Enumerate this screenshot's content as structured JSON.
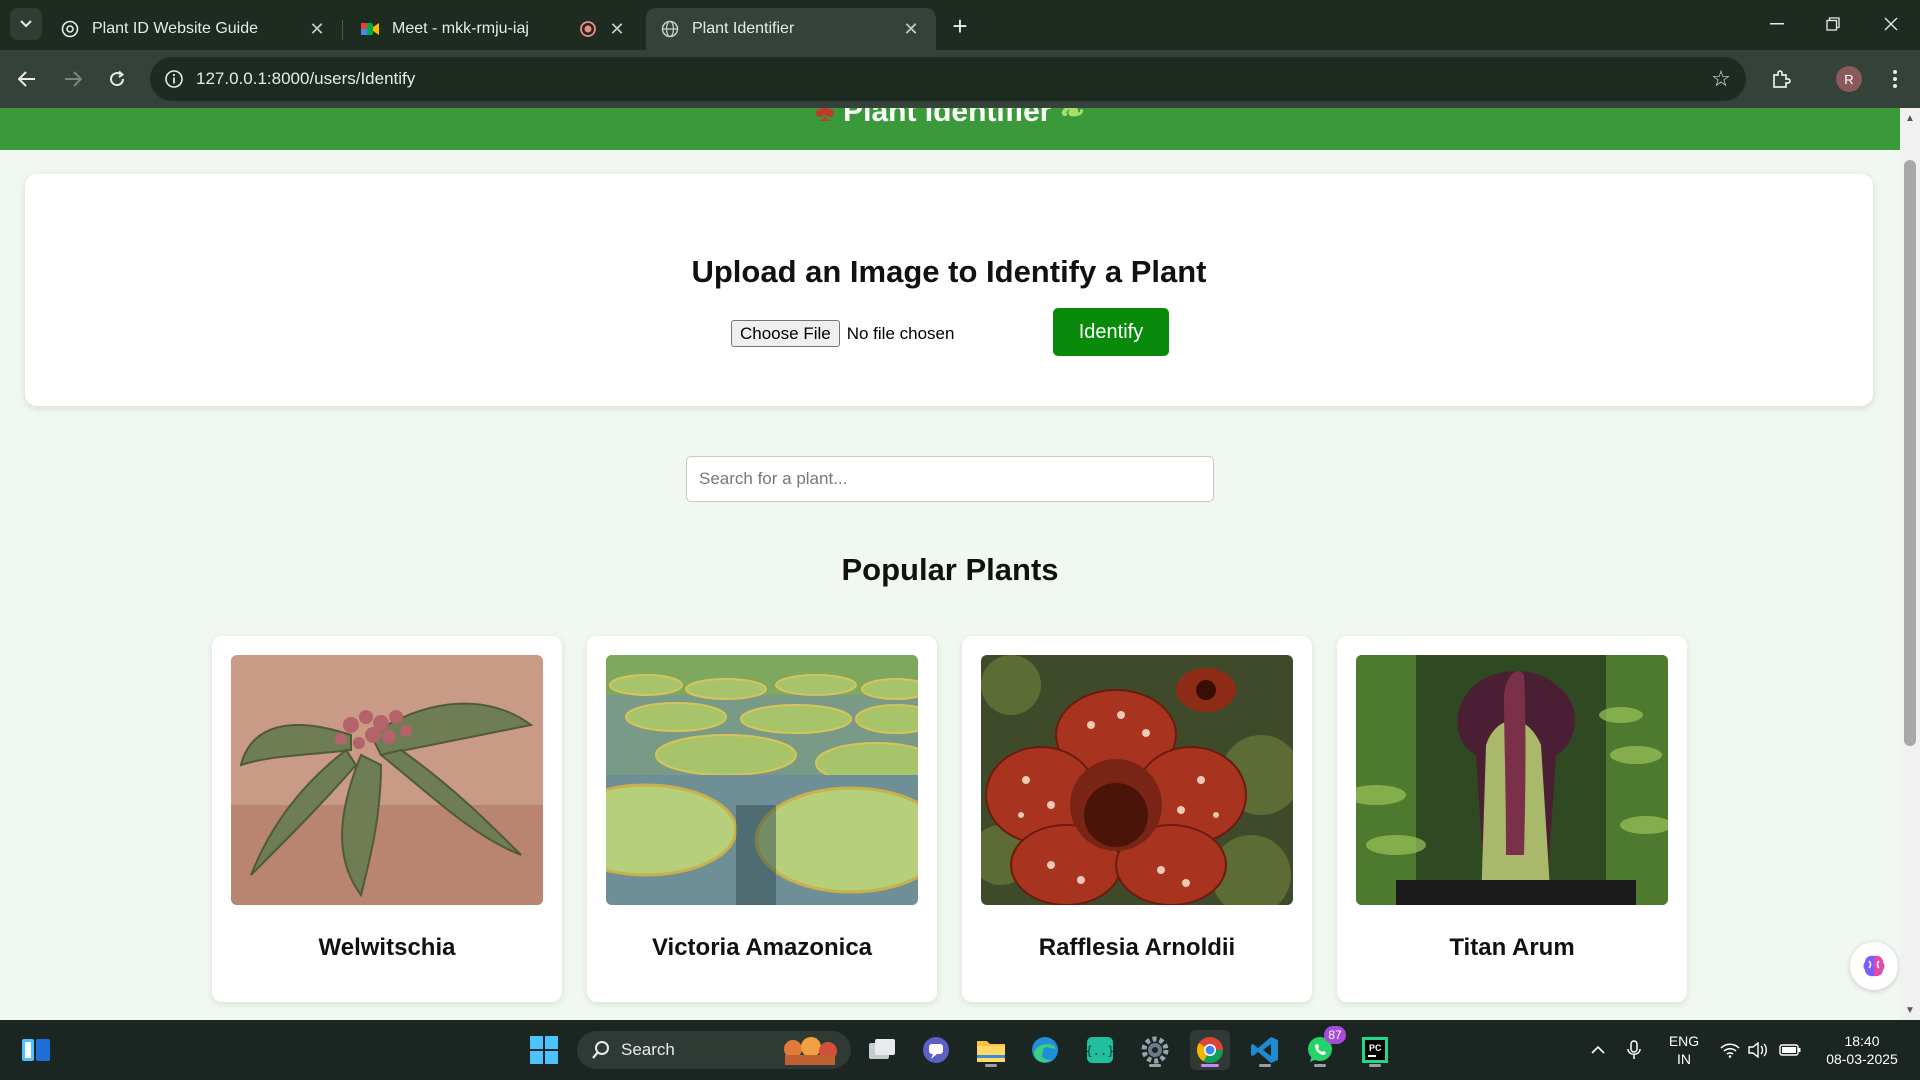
{
  "browser": {
    "tabs": [
      {
        "title": "Plant ID Website Guide"
      },
      {
        "title": "Meet - mkk-rmju-iaj"
      },
      {
        "title": "Plant Identifier"
      }
    ],
    "url": "127.0.0.1:8000/users/Identify",
    "profile_initial": "R"
  },
  "page": {
    "header_title": "Plant Identifier",
    "upload_title": "Upload an Image to Identify a Plant",
    "choose_file_label": "Choose File",
    "no_file_text": "No file chosen",
    "identify_label": "Identify",
    "search_placeholder": "Search for a plant...",
    "popular_title": "Popular Plants",
    "plants": [
      {
        "name": "Welwitschia",
        "image": "welwitschia-photo"
      },
      {
        "name": "Victoria Amazonica",
        "image": "giant-water-lily-photo"
      },
      {
        "name": "Rafflesia Arnoldii",
        "image": "rafflesia-flower-photo"
      },
      {
        "name": "Titan Arum",
        "image": "titan-arum-flower-photo"
      }
    ]
  },
  "taskbar": {
    "search_label": "Search",
    "whatsapp_badge": "87",
    "lang_line1": "ENG",
    "lang_line2": "IN",
    "time": "18:40",
    "date": "08-03-2025"
  }
}
